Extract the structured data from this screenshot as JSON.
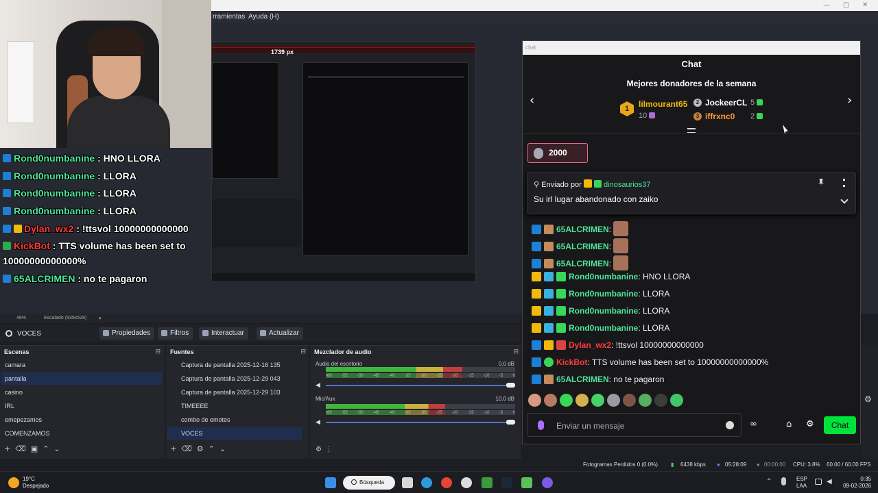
{
  "window": {
    "minimize": "—",
    "maximize": "▢",
    "close": "✕"
  },
  "menu": {
    "tools": "rramientas",
    "help": "Ayuda (H)"
  },
  "preview": {
    "width_label": "1739 px",
    "overlay_chat": [
      {
        "user": "Rond0numbanine",
        "text": ": HNO LLORA"
      },
      {
        "user": "Rond0numbanine",
        "text": ": LLORA"
      },
      {
        "user": "Rond0numbanine",
        "text": ": LLORA"
      },
      {
        "user": "Rond0numbanine",
        "text": ": LLORA"
      },
      {
        "user": "Dylan_wx2",
        "text": ": !ttsvol 10000000000000"
      },
      {
        "user": "KickBot",
        "text": ": TTS volume has been set to"
      },
      {
        "user": "",
        "text": "10000000000000%"
      },
      {
        "user": "65ALCRIMEN",
        "text": ": no te pagaron"
      }
    ]
  },
  "chat": {
    "window_title": "chat",
    "title": "Chat",
    "donors_title": "Mejores donadores de la semana",
    "prev_icon": "‹",
    "next_icon": "›",
    "donors": [
      {
        "rank": "1",
        "name": "lilmourant65",
        "amount": "10"
      },
      {
        "rank": "2",
        "name": "JockeerCL",
        "amount": "5"
      },
      {
        "rank": "3",
        "name": "iffrxnc0",
        "amount": "2"
      }
    ],
    "bits": "2000",
    "pinned": {
      "sent_by": "Enviado por",
      "user": "dinosaurios37",
      "text": "Su irl lugar abandonado con zaiko"
    },
    "messages": [
      {
        "user": "65ALCRIMEN",
        "sep": ":",
        "text": "",
        "color": "#4ee59a"
      },
      {
        "user": "65ALCRIMEN",
        "sep": ":",
        "text": "",
        "color": "#4ee59a"
      },
      {
        "user": "65ALCRIMEN",
        "sep": ":",
        "text": "",
        "color": "#4ee59a"
      },
      {
        "user": "Rond0numbanine",
        "sep": ":",
        "text": "HNO LLORA",
        "color": "#4ee59a"
      },
      {
        "user": "Rond0numbanine",
        "sep": ":",
        "text": "LLORA",
        "color": "#4ee59a"
      },
      {
        "user": "Rond0numbanine",
        "sep": ":",
        "text": "LLORA",
        "color": "#4ee59a"
      },
      {
        "user": "Rond0numbanine",
        "sep": ":",
        "text": "LLORA",
        "color": "#4ee59a"
      },
      {
        "user": "Dylan_wx2",
        "sep": ":",
        "text": "!ttsvol 10000000000000",
        "color": "#ff3b3b"
      },
      {
        "user": "KickBot",
        "sep": ":",
        "text": "TTS volume has been set to 10000000000000%",
        "color": "#ff3b3b"
      },
      {
        "user": "65ALCRIMEN",
        "sep": ":",
        "text": "no te pagaron",
        "color": "#4ee59a"
      }
    ],
    "input_placeholder": "Enviar un mensaje",
    "send_label": "Chat"
  },
  "zoom": {
    "percent": "48%",
    "scale": "Escalado (939x528)"
  },
  "context": {
    "source": "VOCES",
    "buttons": [
      "Propiedades",
      "Filtros",
      "Interactuar",
      "Actualizar"
    ]
  },
  "scenes": {
    "title": "Escenas",
    "items": [
      "camara",
      "pantalla",
      "casino",
      "IRL",
      "emepezamos",
      "COMENZAMOS"
    ],
    "selected": 1
  },
  "sources": {
    "title": "Fuentes",
    "items": [
      "Captura de pantalla 2025-12-16 135",
      "Captura de pantalla 2025-12-29 043",
      "Captura de pantalla 2025-12-29 103",
      "TIMEEEE",
      "combo de emotes",
      "VOCES"
    ],
    "selected": 5
  },
  "mixer": {
    "title": "Mezclador de audio",
    "channels": [
      {
        "name": "Audio del escritorio",
        "db": "0.0 dB",
        "level": 0.72
      },
      {
        "name": "Mic/Aux",
        "db": "10.0 dB",
        "level": 0.63
      }
    ],
    "scale": [
      "-60",
      "-55",
      "-50",
      "-45",
      "-40",
      "-35",
      "-30",
      "-25",
      "-20",
      "-15",
      "-10",
      "-5",
      "0"
    ]
  },
  "status": {
    "dropped": "Fotogramas Perdidos 0 (0.0%)",
    "kbps": "6438 kbps",
    "live": "05:28:09",
    "rec": "00:00:00",
    "cpu": "CPU: 3.8%",
    "fps": "60.00 / 60.00 FPS"
  },
  "taskbar": {
    "temp": "19°C",
    "weather": "Despejado",
    "search": "Búsqueda",
    "lang1": "ESP",
    "lang2": "LAA",
    "time": "0:35",
    "date": "09-02-2026"
  }
}
